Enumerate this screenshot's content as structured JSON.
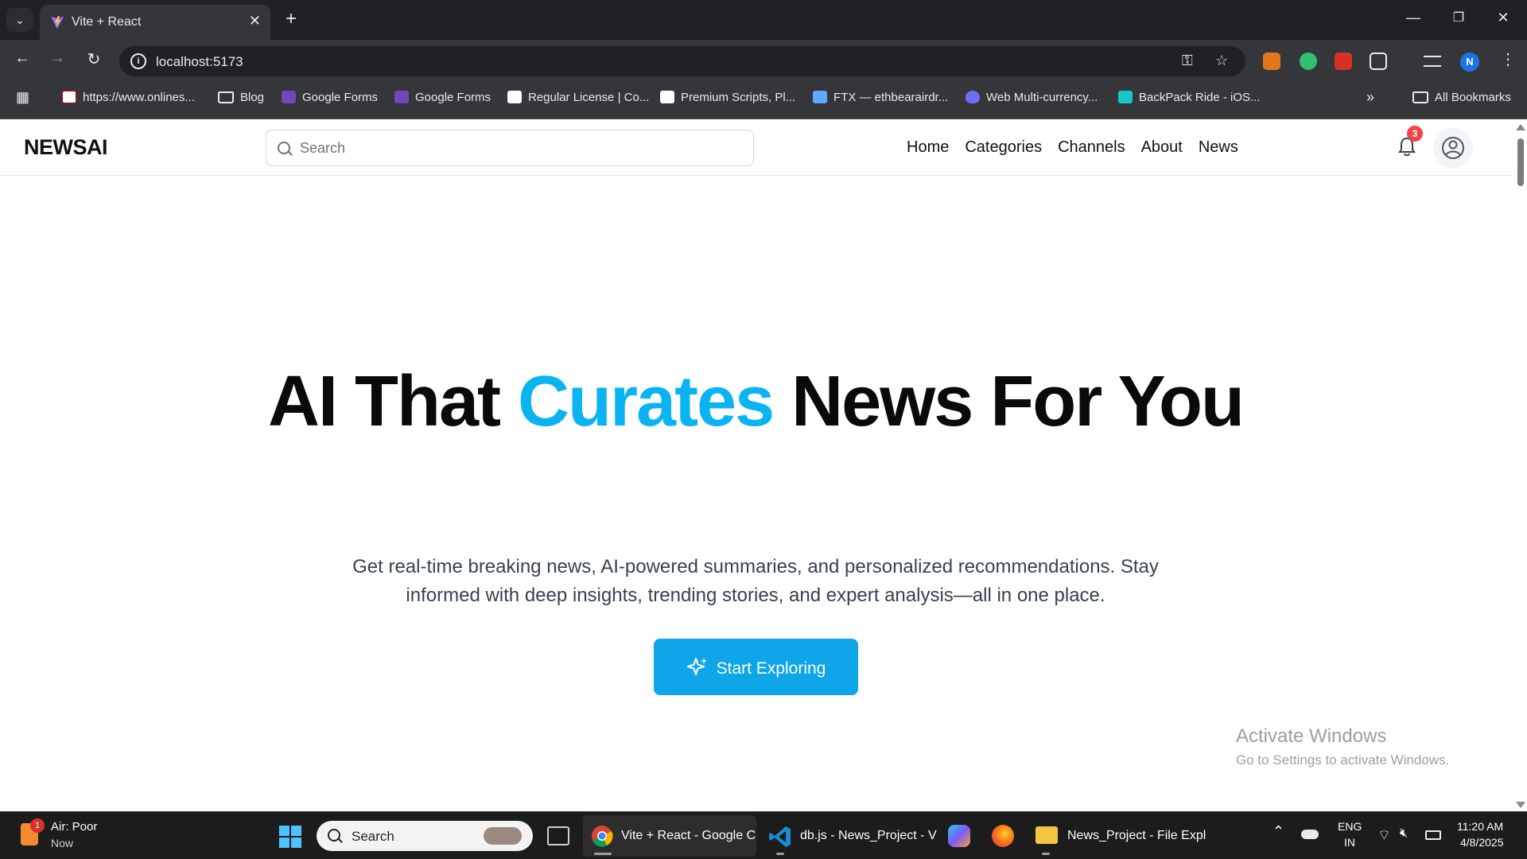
{
  "browser": {
    "tab_title": "Vite + React",
    "url": "localhost:5173",
    "bookmarks": [
      {
        "label": "https://www.onlines...",
        "type": "site"
      },
      {
        "label": "Blog",
        "type": "folder"
      },
      {
        "label": "Google Forms",
        "type": "site"
      },
      {
        "label": "Google Forms",
        "type": "site"
      },
      {
        "label": "Regular License | Co...",
        "type": "site"
      },
      {
        "label": "Premium Scripts, Pl...",
        "type": "site"
      },
      {
        "label": "FTX — ethbearairdr...",
        "type": "site"
      },
      {
        "label": "Web Multi-currency...",
        "type": "site"
      },
      {
        "label": "BackPack Ride - iOS...",
        "type": "site"
      }
    ],
    "all_bookmarks_label": "All Bookmarks",
    "profile_initial": "N"
  },
  "site": {
    "logo": "NEWSAI",
    "search_placeholder": "Search",
    "nav": [
      "Home",
      "Categories",
      "Channels",
      "About",
      "News"
    ],
    "notification_count": "3"
  },
  "hero": {
    "title_part1": "AI That ",
    "title_accent": "Curates",
    "title_part2": " News For You",
    "subtitle": "Get real-time breaking news, AI-powered summaries, and personalized recommendations. Stay informed with deep insights, trending stories, and expert analysis—all in one place.",
    "cta_label": "Start Exploring"
  },
  "watermark": {
    "line1": "Activate Windows",
    "line2": "Go to Settings to activate Windows."
  },
  "taskbar": {
    "weather_badge": "1",
    "weather_title": "Air: Poor",
    "weather_sub": "Now",
    "search_label": "Search",
    "apps": [
      "Vite + React - Google C",
      "db.js - News_Project - V",
      "News_Project - File Expl"
    ],
    "lang_line1": "ENG",
    "lang_line2": "IN",
    "time": "11:20 AM",
    "date": "4/8/2025"
  },
  "colors": {
    "accent": "#0ab4f2",
    "cta": "#0ea5e9",
    "badge": "#ef4444"
  }
}
